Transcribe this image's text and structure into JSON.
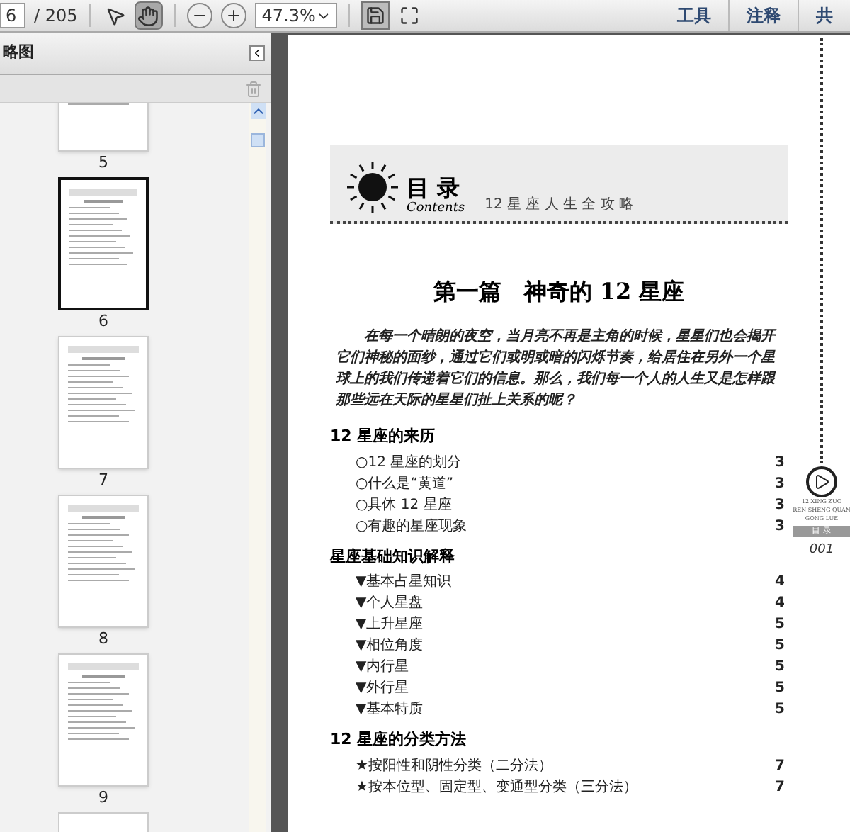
{
  "toolbar": {
    "page_number": "6",
    "page_count": "/ 205",
    "tools": [
      {
        "kind": "select",
        "selected": false
      },
      {
        "kind": "hand",
        "selected": true
      }
    ],
    "zoom": "47.3%",
    "menu": [
      "工具",
      "注释",
      "共"
    ]
  },
  "sidebar": {
    "title": "略图",
    "thumbnails": [
      {
        "label": "5",
        "selected": false
      },
      {
        "label": "6",
        "selected": true
      },
      {
        "label": "7",
        "selected": false
      },
      {
        "label": "8",
        "selected": false
      },
      {
        "label": "9",
        "selected": false
      }
    ]
  },
  "page": {
    "header_title": "目 录",
    "header_subtitle": "Contents",
    "header_tagline": "12 星 座 人 生 全 攻 略",
    "heading": "第一篇　神奇的 12 星座",
    "intro": "在每一个晴朗的夜空，当月亮不再是主角的时候，星星们也会揭开它们神秘的面纱，通过它们或明或暗的闪烁节奏，给居住在另外一个星球上的我们传递着它们的信息。那么，我们每一个人的人生又是怎样跟那些远在天际的星星们扯上关系的呢？",
    "sections": [
      {
        "title": "12 星座的来历",
        "entries": [
          {
            "text": "○12 星座的划分",
            "page": "3"
          },
          {
            "text": "○什么是“黄道”",
            "page": "3"
          },
          {
            "text": "○具体 12 星座",
            "page": "3"
          },
          {
            "text": "○有趣的星座现象",
            "page": "3"
          }
        ]
      },
      {
        "title": "星座基础知识解释",
        "entries": [
          {
            "text": "▼基本占星知识",
            "page": "4"
          },
          {
            "text": "▼个人星盘",
            "page": "4"
          },
          {
            "text": "▼上升星座",
            "page": "5"
          },
          {
            "text": "▼相位角度",
            "page": "5"
          },
          {
            "text": "▼内行星",
            "page": "5"
          },
          {
            "text": "▼外行星",
            "page": "5"
          },
          {
            "text": "▼基本特质",
            "page": "5"
          }
        ]
      },
      {
        "title": "12 星座的分类方法",
        "entries": [
          {
            "text": "★按阳性和阴性分类（二分法）",
            "page": "7"
          },
          {
            "text": "★按本位型、固定型、变通型分类（三分法）",
            "page": "7"
          }
        ]
      }
    ],
    "margin": {
      "lines": [
        "12 XING ZUO",
        "REN SHENG QUAN",
        "GONG LUE"
      ],
      "tab": "目 录",
      "page_number": "001"
    }
  }
}
